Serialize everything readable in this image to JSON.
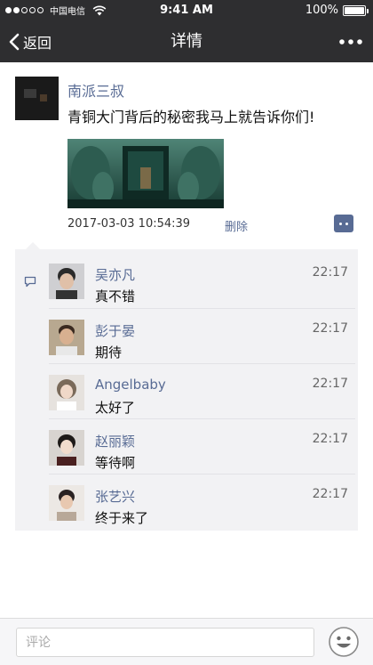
{
  "status_bar": {
    "carrier": "中国电信",
    "time": "9:41 AM",
    "battery": "100%",
    "battery_level": 1.0,
    "signal_dots_filled": 2,
    "signal_dots_total": 5
  },
  "nav": {
    "back_label": "返回",
    "title": "详情"
  },
  "post": {
    "author": "南派三叔",
    "text": "青铜大门背后的秘密我马上就告诉你们!",
    "time": "2017-03-03 10:54:39",
    "delete_label": "删除"
  },
  "comments": [
    {
      "name": "吴亦凡",
      "text": "真不错",
      "time": "22:17"
    },
    {
      "name": "彭于晏",
      "text": "期待",
      "time": "22:17"
    },
    {
      "name": "Angelbaby",
      "text": "太好了",
      "time": "22:17"
    },
    {
      "name": "赵丽颖",
      "text": "等待啊",
      "time": "22:17"
    },
    {
      "name": "张艺兴",
      "text": "终于来了",
      "time": "22:17"
    }
  ],
  "bottom_bar": {
    "comment_placeholder": "评论"
  },
  "colors": {
    "bar_bg": "#2e2e30",
    "link": "#586b94",
    "comment_bg": "#f2f2f4"
  }
}
